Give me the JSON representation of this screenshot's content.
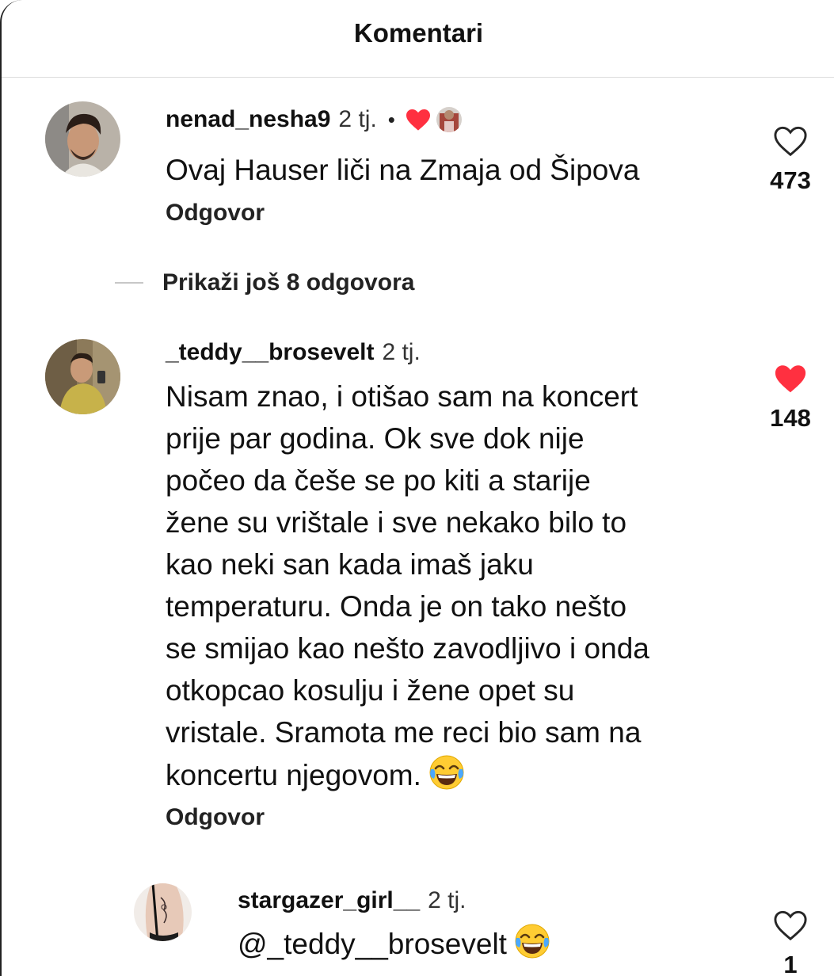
{
  "header": {
    "title": "Komentari"
  },
  "comments": [
    {
      "username": "nenad_nesha9",
      "time": "2 tj.",
      "separator": "•",
      "liked_by_author": true,
      "text": "Ovaj Hauser liči na Zmaja od Šipova",
      "reply_label": "Odgovor",
      "likes": "473",
      "liked": false
    },
    {
      "username": "_teddy__brosevelt",
      "time": "2 tj.",
      "text_lines": [
        "Nisam znao, i otišao sam na koncert",
        "prije par godina. Ok sve dok nije",
        "počeo da češe se po kiti a starije",
        "žene su vrištale i sve nekako bilo to",
        "kao neki san kada imaš jaku",
        "temperaturu. Onda je on tako nešto",
        "se smijao kao nešto zavodljivo i onda",
        "otkopcao kosulju i žene opet su",
        "vristale. Sramota me reci bio sam na",
        "koncertu njegovom."
      ],
      "emoji": "face-with-tears-of-joy",
      "reply_label": "Odgovor",
      "likes": "148",
      "liked": true
    }
  ],
  "more_replies": {
    "label": "Prikaži još 8 odgovora"
  },
  "reply": {
    "username": "stargazer_girl__",
    "time": "2 tj.",
    "text": "@_teddy__brosevelt",
    "emoji": "face-with-tears-of-joy",
    "likes": "1",
    "liked": false
  },
  "colors": {
    "like_red": "#ff3040",
    "divider": "#dbdbdb",
    "text": "#111111"
  }
}
